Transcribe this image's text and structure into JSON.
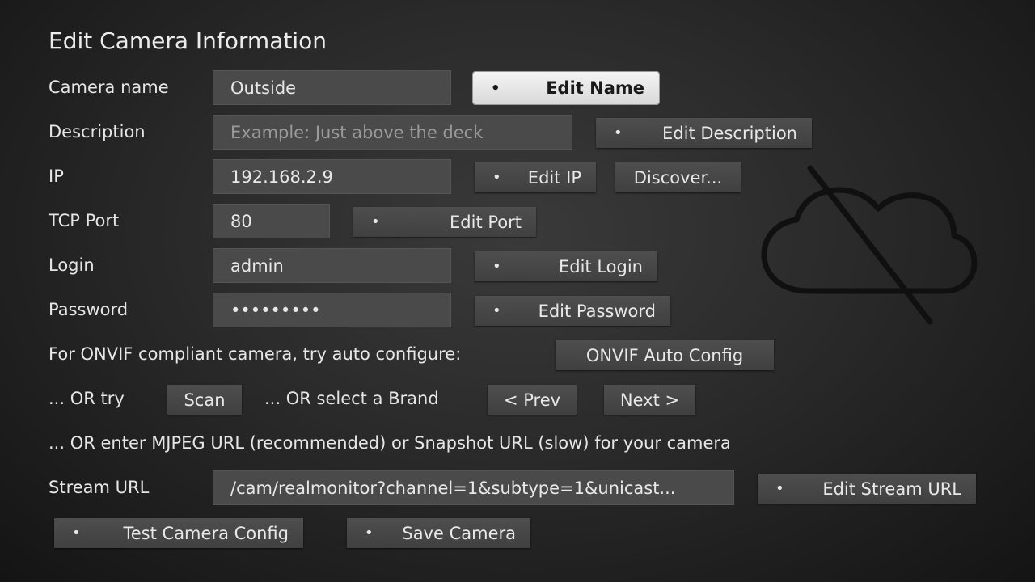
{
  "title": "Edit Camera Information",
  "fields": {
    "camera_name": {
      "label": "Camera name",
      "value": "Outside",
      "button": "Edit Name"
    },
    "description": {
      "label": "Description",
      "placeholder": "Example: Just above the deck",
      "button": "Edit Description"
    },
    "ip": {
      "label": "IP",
      "value": "192.168.2.9",
      "button": "Edit IP",
      "discover": "Discover..."
    },
    "tcp_port": {
      "label": "TCP Port",
      "value": "80",
      "button": "Edit Port"
    },
    "login": {
      "label": "Login",
      "value": "admin",
      "button": "Edit Login"
    },
    "password": {
      "label": "Password",
      "value": "•••••••••",
      "button": "Edit Password"
    }
  },
  "onvif": {
    "text": "For ONVIF compliant camera, try auto configure:",
    "button": "ONVIF Auto Config"
  },
  "brand": {
    "or_try": "... OR try",
    "scan": "Scan",
    "or_select": "... OR select a Brand",
    "prev": "< Prev",
    "next": "Next >"
  },
  "mjpeg_hint": "... OR enter MJPEG URL (recommended) or Snapshot URL (slow) for your camera",
  "stream": {
    "label": "Stream URL",
    "value": "/cam/realmonitor?channel=1&subtype=1&unicast...",
    "button": "Edit Stream URL"
  },
  "actions": {
    "test": "Test Camera Config",
    "save": "Save Camera"
  },
  "bullet": "•",
  "icons": {
    "background": "cloud-off-icon"
  }
}
